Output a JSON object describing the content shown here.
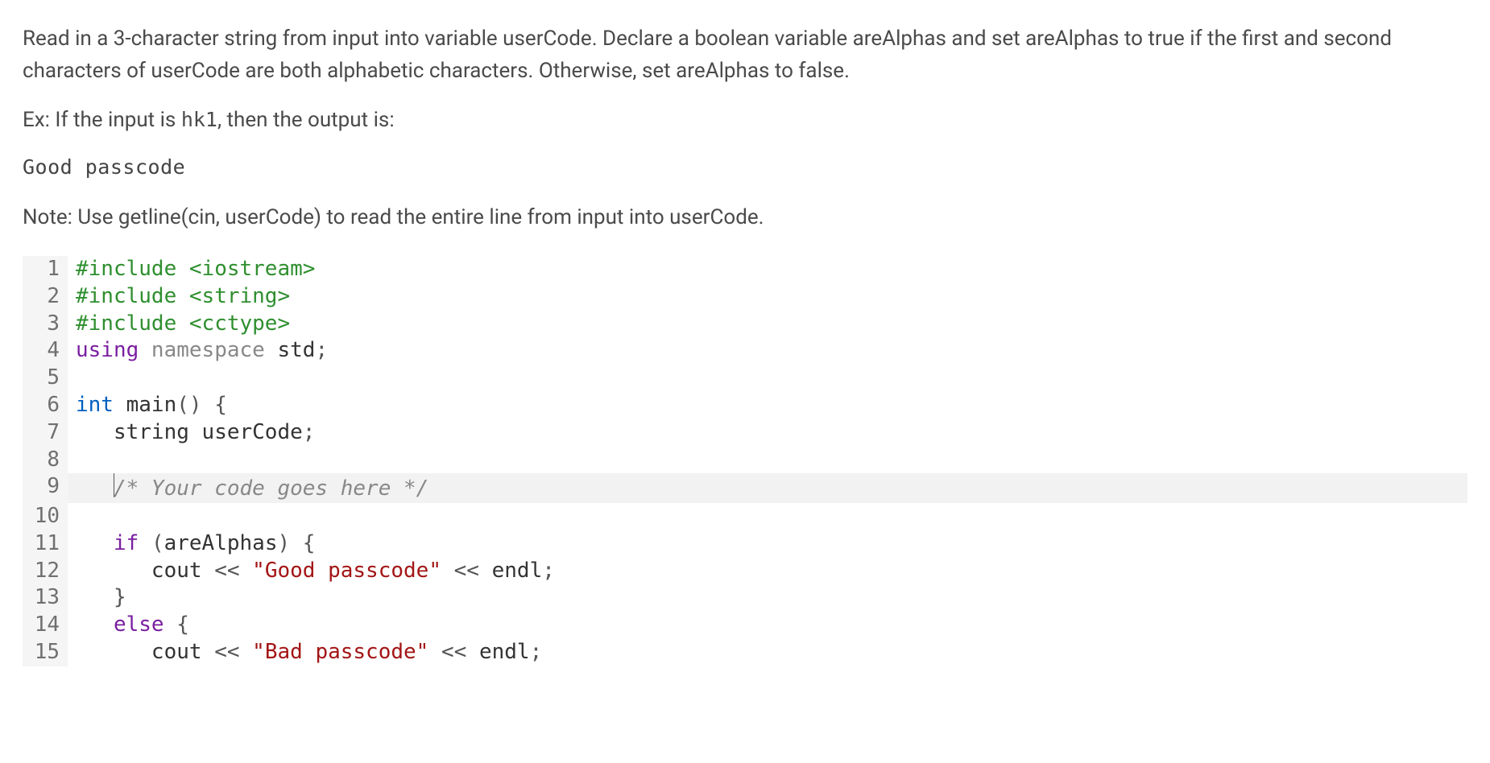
{
  "instructions": {
    "para1": "Read in a 3-character string from input into variable userCode. Declare a boolean variable areAlphas and set areAlphas to true if the first and second characters of userCode are both alphabetic characters. Otherwise, set areAlphas to false.",
    "example_prefix": "Ex: If the input is ",
    "example_code": "hk1",
    "example_suffix": ", then the output is:",
    "output_text": "Good passcode",
    "note": "Note: Use getline(cin, userCode) to read the entire line from input into userCode."
  },
  "editor": {
    "active_line": 9,
    "lines": [
      {
        "n": 1,
        "tokens": [
          {
            "t": "#include ",
            "c": "tok-pre"
          },
          {
            "t": "<iostream>",
            "c": "tok-pre"
          }
        ]
      },
      {
        "n": 2,
        "tokens": [
          {
            "t": "#include ",
            "c": "tok-pre"
          },
          {
            "t": "<string>",
            "c": "tok-pre"
          }
        ]
      },
      {
        "n": 3,
        "tokens": [
          {
            "t": "#include ",
            "c": "tok-pre"
          },
          {
            "t": "<cctype>",
            "c": "tok-pre"
          }
        ]
      },
      {
        "n": 4,
        "tokens": [
          {
            "t": "using ",
            "c": "tok-kw2"
          },
          {
            "t": "namespace ",
            "c": "tok-ns"
          },
          {
            "t": "std",
            "c": "tok-id"
          },
          {
            "t": ";",
            "c": "tok-pun"
          }
        ]
      },
      {
        "n": 5,
        "tokens": [
          {
            "t": "",
            "c": ""
          }
        ]
      },
      {
        "n": 6,
        "tokens": [
          {
            "t": "int ",
            "c": "tok-ty"
          },
          {
            "t": "main",
            "c": "tok-fn"
          },
          {
            "t": "() {",
            "c": "tok-pun"
          }
        ]
      },
      {
        "n": 7,
        "tokens": [
          {
            "t": "   ",
            "c": ""
          },
          {
            "t": "string",
            "c": "tok-id"
          },
          {
            "t": " userCode",
            "c": "tok-id"
          },
          {
            "t": ";",
            "c": "tok-pun"
          }
        ]
      },
      {
        "n": 8,
        "tokens": [
          {
            "t": "",
            "c": ""
          }
        ]
      },
      {
        "n": 9,
        "tokens": [
          {
            "t": "   ",
            "c": ""
          },
          {
            "t": "CURSOR",
            "c": "cursor-marker"
          },
          {
            "t": "/* Your code goes here */",
            "c": "tok-cmt"
          }
        ]
      },
      {
        "n": 10,
        "tokens": [
          {
            "t": "",
            "c": ""
          }
        ]
      },
      {
        "n": 11,
        "tokens": [
          {
            "t": "   ",
            "c": ""
          },
          {
            "t": "if ",
            "c": "tok-kw"
          },
          {
            "t": "(",
            "c": "tok-pun"
          },
          {
            "t": "areAlphas",
            "c": "tok-id"
          },
          {
            "t": ") {",
            "c": "tok-pun"
          }
        ]
      },
      {
        "n": 12,
        "tokens": [
          {
            "t": "      ",
            "c": ""
          },
          {
            "t": "cout",
            "c": "tok-id"
          },
          {
            "t": " << ",
            "c": "tok-pun"
          },
          {
            "t": "\"Good passcode\"",
            "c": "tok-str"
          },
          {
            "t": " << ",
            "c": "tok-pun"
          },
          {
            "t": "endl",
            "c": "tok-id"
          },
          {
            "t": ";",
            "c": "tok-pun"
          }
        ]
      },
      {
        "n": 13,
        "tokens": [
          {
            "t": "   ",
            "c": ""
          },
          {
            "t": "}",
            "c": "tok-pun"
          }
        ]
      },
      {
        "n": 14,
        "tokens": [
          {
            "t": "   ",
            "c": ""
          },
          {
            "t": "else ",
            "c": "tok-kw"
          },
          {
            "t": "{",
            "c": "tok-pun"
          }
        ]
      },
      {
        "n": 15,
        "tokens": [
          {
            "t": "      ",
            "c": ""
          },
          {
            "t": "cout",
            "c": "tok-id"
          },
          {
            "t": " << ",
            "c": "tok-pun"
          },
          {
            "t": "\"Bad passcode\"",
            "c": "tok-str"
          },
          {
            "t": " << ",
            "c": "tok-pun"
          },
          {
            "t": "endl",
            "c": "tok-id"
          },
          {
            "t": ";",
            "c": "tok-pun"
          }
        ]
      }
    ]
  }
}
